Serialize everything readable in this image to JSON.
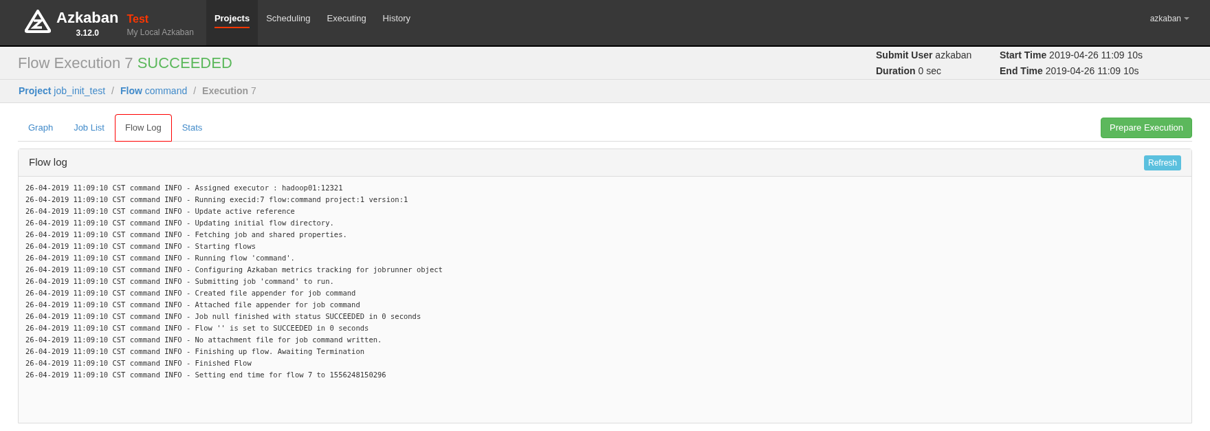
{
  "navbar": {
    "brand": "Azkaban",
    "version": "3.12.0",
    "env_name": "Test",
    "env_desc": "My Local Azkaban",
    "nav_items": [
      {
        "label": "Projects",
        "selected": true
      },
      {
        "label": "Scheduling",
        "selected": false
      },
      {
        "label": "Executing",
        "selected": false
      },
      {
        "label": "History",
        "selected": false
      }
    ],
    "user": "azkaban"
  },
  "header": {
    "title": "Flow Execution 7",
    "status": "SUCCEEDED",
    "meta": [
      {
        "label": "Submit User",
        "value": "azkaban"
      },
      {
        "label": "Start Time",
        "value": "2019-04-26 11:09 10s"
      },
      {
        "label": "Duration",
        "value": "0 sec"
      },
      {
        "label": "End Time",
        "value": "2019-04-26 11:09 10s"
      }
    ]
  },
  "breadcrumb_separator": "/",
  "breadcrumb": [
    {
      "label": "Project",
      "value": "job_init_test",
      "link": true
    },
    {
      "label": "Flow",
      "value": "command",
      "link": true
    },
    {
      "label": "Execution",
      "value": "7",
      "link": false
    }
  ],
  "tabs": [
    {
      "label": "Graph",
      "selected": false,
      "outlined": false
    },
    {
      "label": "Job List",
      "selected": false,
      "outlined": false
    },
    {
      "label": "Flow Log",
      "selected": true,
      "outlined": true
    },
    {
      "label": "Stats",
      "selected": false,
      "outlined": false
    }
  ],
  "prepare_button": "Prepare Execution",
  "panel": {
    "title": "Flow log",
    "refresh_button": "Refresh",
    "lines": [
      "26-04-2019 11:09:10 CST command INFO - Assigned executor : hadoop01:12321",
      "26-04-2019 11:09:10 CST command INFO - Running execid:7 flow:command project:1 version:1",
      "26-04-2019 11:09:10 CST command INFO - Update active reference",
      "26-04-2019 11:09:10 CST command INFO - Updating initial flow directory.",
      "26-04-2019 11:09:10 CST command INFO - Fetching job and shared properties.",
      "26-04-2019 11:09:10 CST command INFO - Starting flows",
      "26-04-2019 11:09:10 CST command INFO - Running flow 'command'.",
      "26-04-2019 11:09:10 CST command INFO - Configuring Azkaban metrics tracking for jobrunner object",
      "26-04-2019 11:09:10 CST command INFO - Submitting job 'command' to run.",
      "26-04-2019 11:09:10 CST command INFO - Created file appender for job command",
      "26-04-2019 11:09:10 CST command INFO - Attached file appender for job command",
      "26-04-2019 11:09:10 CST command INFO - Job null finished with status SUCCEEDED in 0 seconds",
      "26-04-2019 11:09:10 CST command INFO - Flow '' is set to SUCCEEDED in 0 seconds",
      "26-04-2019 11:09:10 CST command INFO - No attachment file for job command written.",
      "26-04-2019 11:09:10 CST command INFO - Finishing up flow. Awaiting Termination",
      "26-04-2019 11:09:10 CST command INFO - Finished Flow",
      "26-04-2019 11:09:10 CST command INFO - Setting end time for flow 7 to 1556248150296"
    ]
  }
}
